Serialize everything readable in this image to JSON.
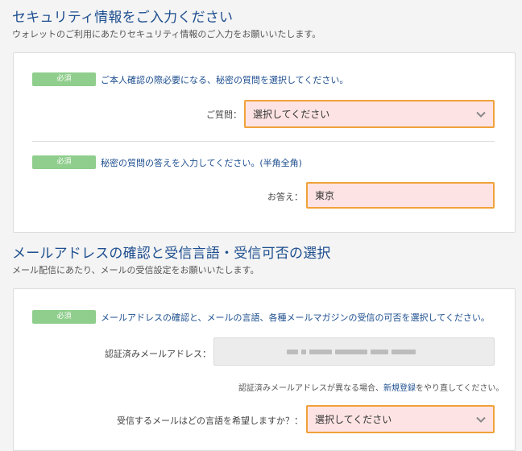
{
  "security": {
    "title": "セキュリティ情報をご入力ください",
    "subtitle": "ウォレットのご利用にあたりセキュリティ情報のご入力をお願いいたします。",
    "q1": {
      "badge": "必須",
      "text": "ご本人確認の際必要になる、秘密の質問を選択してください。",
      "label": "ご質問：",
      "value": "選択してください"
    },
    "q2": {
      "badge": "必須",
      "text": "秘密の質問の答えを入力してください。(半角全角)",
      "label": "お答え：",
      "value": "東京"
    }
  },
  "email_section": {
    "title": "メールアドレスの確認と受信言語・受信可否の選択",
    "subtitle": "メール配信にあたり、メールの受信設定をお願いいたします。",
    "block": {
      "badge": "必須",
      "text": "メールアドレスの確認と、メールの言語、各種メールマガジンの受信の可否を選択してください。",
      "email_label": "認証済みメールアドレス：",
      "note_before": "認証済みメールアドレスが異なる場合、",
      "note_link": "新規登録",
      "note_after": "をやり直してください。",
      "language_label": "受信するメールはどの言語を希望しますか？：",
      "language_value": "選択してください"
    }
  },
  "colors": {
    "heading": "#1d4e8f",
    "badge": "#8fce8c",
    "field_bg": "#fde3e3",
    "field_border": "#f0a23a"
  },
  "icons": [
    "chevron-down-icon"
  ]
}
